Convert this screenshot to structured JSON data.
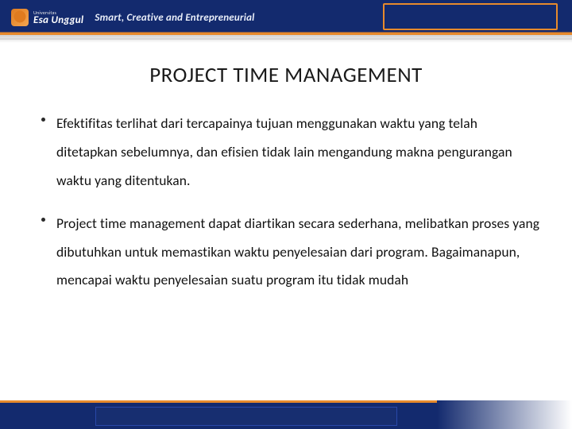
{
  "header": {
    "logo_small": "Universitas",
    "logo_main": "Esa Unggul",
    "tagline": "Smart, Creative and Entrepreneurial"
  },
  "slide": {
    "title": "PROJECT TIME MANAGEMENT",
    "bullets": [
      "Efektifitas terlihat dari tercapainya tujuan menggunakan waktu yang telah ditetapkan sebelumnya, dan efisien tidak lain mengandung makna pengurangan waktu yang ditentukan.",
      "Project time management dapat diartikan secara sederhana, melibatkan proses yang dibutuhkan untuk memastikan waktu penyelesaian dari program. Bagaimanapun, mencapai waktu penyelesaian suatu program itu tidak mudah"
    ]
  }
}
